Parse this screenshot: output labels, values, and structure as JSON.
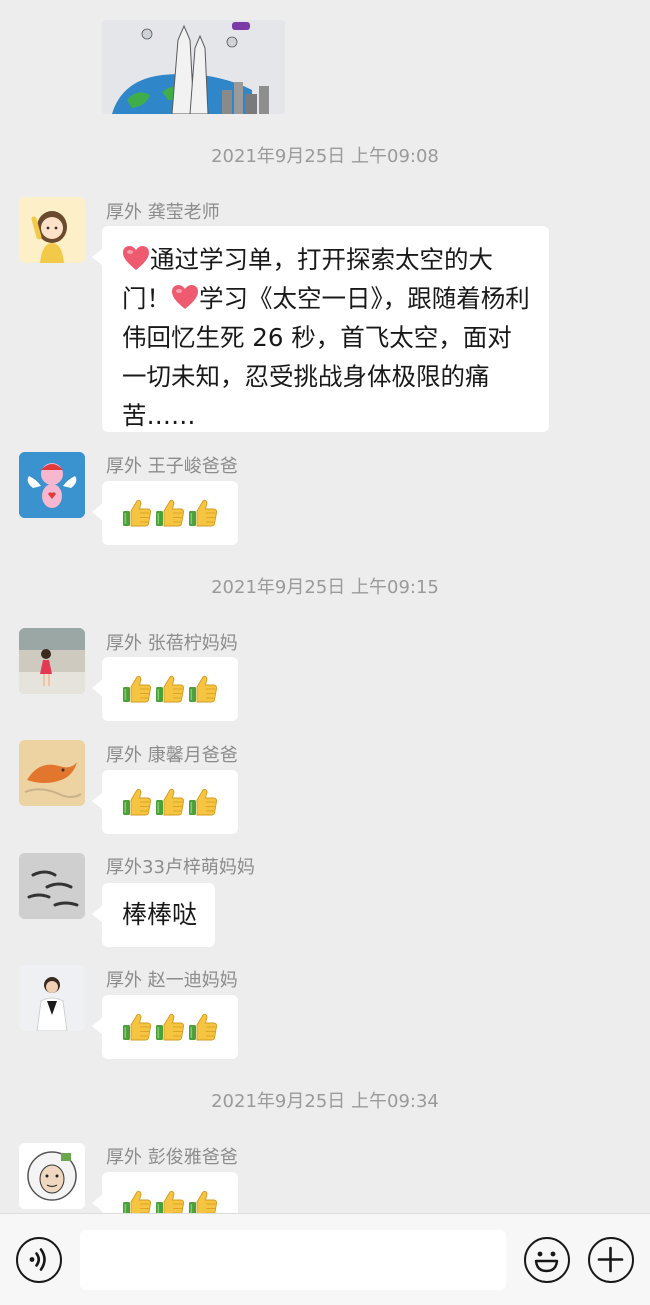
{
  "timestamps": [
    "2021年9月25日 上午09:08",
    "2021年9月25日 上午09:15",
    "2021年9月25日 上午09:34"
  ],
  "messages": [
    {
      "sender": "厚外   龚莹老师",
      "parts": [
        "通过学习单，打开探索太空的大门！",
        "学习《太空一日》，跟随着杨利伟回忆生死 26 秒，首飞太空，面对一切未知，忍受挑战身体极限的痛苦……"
      ],
      "emoji": [
        "red-heart",
        "red-heart"
      ]
    },
    {
      "sender": "厚外   王子峻爸爸",
      "content": [
        "thumbs-up",
        "thumbs-up",
        "thumbs-up"
      ]
    },
    {
      "sender": "厚外   张蓓柠妈妈",
      "content": [
        "thumbs-up",
        "thumbs-up",
        "thumbs-up"
      ]
    },
    {
      "sender": "厚外   康馨月爸爸",
      "content": [
        "thumbs-up",
        "thumbs-up",
        "thumbs-up"
      ]
    },
    {
      "sender": "厚外33卢梓萌妈妈",
      "text": "棒棒哒"
    },
    {
      "sender": "厚外   赵一迪妈妈",
      "content": [
        "thumbs-up",
        "thumbs-up",
        "thumbs-up"
      ]
    },
    {
      "sender": "厚外   彭俊雅爸爸",
      "content": [
        "thumbs-up",
        "thumbs-up",
        "thumbs-up"
      ]
    }
  ],
  "input_bar": {
    "voice_icon": "voice-icon",
    "input_value": "",
    "emoji_icon": "emoji-icon",
    "plus_icon": "plus-icon"
  },
  "colors": {
    "background": "#ededed",
    "bubble": "#ffffff",
    "timestamp_text": "#9a9a9a",
    "sender_text": "#8c8c8c",
    "message_text": "#191919",
    "heart": "#ee5a6f",
    "thumb_yellow": "#f5c542",
    "thumb_cuff_green": "#4aa03a"
  }
}
